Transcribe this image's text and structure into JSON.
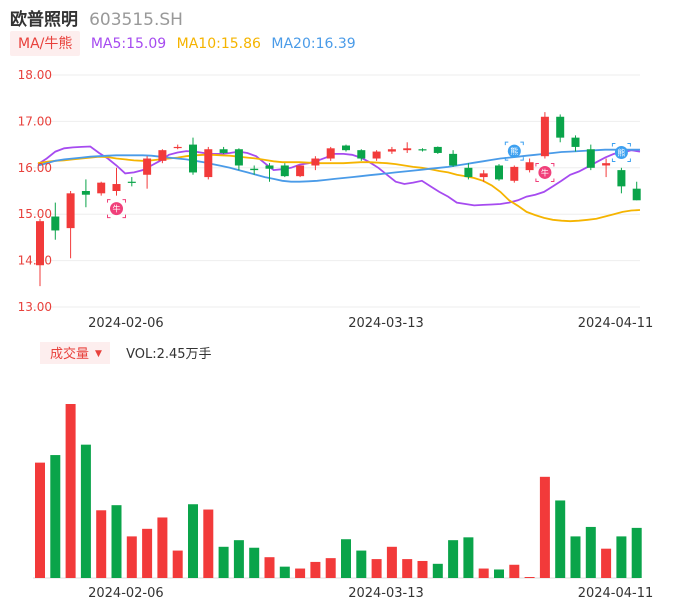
{
  "header": {
    "stock_name": "欧普照明",
    "stock_code": "603515.SH"
  },
  "ma_legend": {
    "tag": "MA/牛熊",
    "items": [
      {
        "label": "MA5:15.09",
        "color": "#a64bf0"
      },
      {
        "label": "MA10:15.86",
        "color": "#f5b400"
      },
      {
        "label": "MA20:16.39",
        "color": "#4a9be8"
      }
    ]
  },
  "volume_legend": {
    "tag": "成交量",
    "text": "VOL:2.45万手"
  },
  "colors": {
    "up": "#f23a3a",
    "down": "#0aa44a",
    "grid": "#eeeeee",
    "axis_label": "#e8413c",
    "bull_marker": "#f0407a",
    "bear_marker": "#3da0f0"
  },
  "chart_data": [
    {
      "type": "candlestick",
      "ylim": [
        13.0,
        18.0
      ],
      "yticks": [
        "13.00",
        "14.00",
        "15.00",
        "16.00",
        "17.00",
        "18.00"
      ],
      "xticks": [
        {
          "index": 3,
          "label": "2024-02-06"
        },
        {
          "index": 20,
          "label": "2024-03-13"
        },
        {
          "index": 35,
          "label": "2024-04-11"
        }
      ],
      "candles": [
        {
          "o": 13.9,
          "h": 14.9,
          "l": 13.45,
          "c": 14.85
        },
        {
          "o": 14.95,
          "h": 15.25,
          "l": 14.45,
          "c": 14.65
        },
        {
          "o": 14.7,
          "h": 15.5,
          "l": 14.05,
          "c": 15.45
        },
        {
          "o": 15.5,
          "h": 15.75,
          "l": 15.15,
          "c": 15.42
        },
        {
          "o": 15.45,
          "h": 15.7,
          "l": 15.4,
          "c": 15.68
        },
        {
          "o": 15.5,
          "h": 16.0,
          "l": 15.4,
          "c": 15.65
        },
        {
          "o": 15.7,
          "h": 15.8,
          "l": 15.6,
          "c": 15.68
        },
        {
          "o": 15.85,
          "h": 16.25,
          "l": 15.55,
          "c": 16.2
        },
        {
          "o": 16.15,
          "h": 16.4,
          "l": 16.1,
          "c": 16.38
        },
        {
          "o": 16.45,
          "h": 16.5,
          "l": 16.4,
          "c": 16.45
        },
        {
          "o": 16.5,
          "h": 16.65,
          "l": 15.85,
          "c": 15.9
        },
        {
          "o": 15.8,
          "h": 16.45,
          "l": 15.75,
          "c": 16.4
        },
        {
          "o": 16.4,
          "h": 16.45,
          "l": 16.3,
          "c": 16.32
        },
        {
          "o": 16.4,
          "h": 16.42,
          "l": 15.95,
          "c": 16.05
        },
        {
          "o": 15.98,
          "h": 16.05,
          "l": 15.85,
          "c": 15.95
        },
        {
          "o": 16.05,
          "h": 16.1,
          "l": 15.7,
          "c": 15.98
        },
        {
          "o": 16.05,
          "h": 16.1,
          "l": 15.8,
          "c": 15.82
        },
        {
          "o": 15.82,
          "h": 16.05,
          "l": 15.8,
          "c": 16.05
        },
        {
          "o": 16.05,
          "h": 16.25,
          "l": 15.95,
          "c": 16.2
        },
        {
          "o": 16.2,
          "h": 16.45,
          "l": 16.15,
          "c": 16.42
        },
        {
          "o": 16.48,
          "h": 16.5,
          "l": 16.35,
          "c": 16.38
        },
        {
          "o": 16.38,
          "h": 16.4,
          "l": 16.15,
          "c": 16.2
        },
        {
          "o": 16.2,
          "h": 16.38,
          "l": 16.15,
          "c": 16.35
        },
        {
          "o": 16.35,
          "h": 16.45,
          "l": 16.3,
          "c": 16.4
        },
        {
          "o": 16.38,
          "h": 16.55,
          "l": 16.32,
          "c": 16.42
        },
        {
          "o": 16.4,
          "h": 16.42,
          "l": 16.35,
          "c": 16.38
        },
        {
          "o": 16.45,
          "h": 16.46,
          "l": 16.3,
          "c": 16.32
        },
        {
          "o": 16.3,
          "h": 16.38,
          "l": 16.02,
          "c": 16.05
        },
        {
          "o": 16.0,
          "h": 16.1,
          "l": 15.75,
          "c": 15.8
        },
        {
          "o": 15.8,
          "h": 15.95,
          "l": 15.7,
          "c": 15.88
        },
        {
          "o": 16.05,
          "h": 16.08,
          "l": 15.72,
          "c": 15.75
        },
        {
          "o": 15.72,
          "h": 16.05,
          "l": 15.68,
          "c": 16.02
        },
        {
          "o": 15.95,
          "h": 16.2,
          "l": 15.9,
          "c": 16.12
        },
        {
          "o": 16.25,
          "h": 17.2,
          "l": 16.2,
          "c": 17.1
        },
        {
          "o": 17.1,
          "h": 17.15,
          "l": 16.55,
          "c": 16.65
        },
        {
          "o": 16.65,
          "h": 16.7,
          "l": 16.35,
          "c": 16.45
        },
        {
          "o": 16.4,
          "h": 16.5,
          "l": 15.95,
          "c": 16.0
        },
        {
          "o": 16.05,
          "h": 16.2,
          "l": 15.8,
          "c": 16.1
        },
        {
          "o": 15.95,
          "h": 16.0,
          "l": 15.45,
          "c": 15.6
        },
        {
          "o": 15.55,
          "h": 15.7,
          "l": 15.3,
          "c": 15.3
        }
      ],
      "ma5": [
        16.08,
        16.2,
        16.35,
        16.42,
        16.44,
        16.45,
        16.46,
        16.32,
        16.2,
        16.05,
        15.88,
        15.9,
        15.95,
        16.05,
        16.15,
        16.28,
        16.33,
        16.36,
        16.35,
        16.32,
        16.3,
        16.3,
        16.32,
        16.35,
        16.32,
        16.25,
        16.1,
        15.95,
        15.97,
        16.0,
        16.07,
        16.1,
        16.15,
        16.22,
        16.3,
        16.3,
        16.28,
        16.22,
        16.12,
        16.0,
        15.85,
        15.7,
        15.65,
        15.68,
        15.72,
        15.6,
        15.48,
        15.38,
        15.25,
        15.22,
        15.19,
        15.2,
        15.21,
        15.22,
        15.25,
        15.3,
        15.38,
        15.42,
        15.48,
        15.6,
        15.72,
        15.85,
        15.92,
        16.02,
        16.12,
        16.22,
        16.3,
        16.33,
        16.38,
        16.35
      ],
      "ma10": [
        16.1,
        16.13,
        16.15,
        16.16,
        16.18,
        16.2,
        16.22,
        16.24,
        16.23,
        16.2,
        16.18,
        16.16,
        16.15,
        16.16,
        16.18,
        16.2,
        16.22,
        16.25,
        16.27,
        16.28,
        16.28,
        16.27,
        16.26,
        16.24,
        16.22,
        16.2,
        16.17,
        16.14,
        16.12,
        16.12,
        16.12,
        16.11,
        16.1,
        16.1,
        16.1,
        16.1,
        16.11,
        16.12,
        16.12,
        16.11,
        16.1,
        16.08,
        16.05,
        16.02,
        16.0,
        15.97,
        15.93,
        15.9,
        15.85,
        15.82,
        15.78,
        15.72,
        15.62,
        15.48,
        15.3,
        15.18,
        15.05,
        14.98,
        14.92,
        14.88,
        14.86,
        14.85,
        14.86,
        14.88,
        14.9,
        14.95,
        15.0,
        15.05,
        15.08,
        15.09
      ],
      "ma20": [
        16.05,
        16.1,
        16.15,
        16.18,
        16.2,
        16.22,
        16.24,
        16.25,
        16.26,
        16.27,
        16.27,
        16.27,
        16.27,
        16.26,
        16.24,
        16.22,
        16.2,
        16.18,
        16.15,
        16.12,
        16.08,
        16.04,
        16.0,
        15.95,
        15.9,
        15.85,
        15.8,
        15.76,
        15.72,
        15.7,
        15.7,
        15.71,
        15.72,
        15.74,
        15.76,
        15.78,
        15.8,
        15.82,
        15.84,
        15.86,
        15.88,
        15.9,
        15.92,
        15.94,
        15.96,
        15.98,
        16.0,
        16.02,
        16.05,
        16.08,
        16.11,
        16.14,
        16.17,
        16.2,
        16.22,
        16.24,
        16.26,
        16.28,
        16.3,
        16.32,
        16.34,
        16.35,
        16.36,
        16.37,
        16.38,
        16.39,
        16.39,
        16.39,
        16.39,
        16.39
      ],
      "signals": [
        {
          "index": 5,
          "type": "bull",
          "label": "牛",
          "price": 15.12
        },
        {
          "index": 31,
          "type": "bear",
          "label": "熊",
          "price": 16.36
        },
        {
          "index": 33,
          "type": "bull",
          "label": "牛",
          "price": 15.9
        },
        {
          "index": 38,
          "type": "bear",
          "label": "熊",
          "price": 16.33
        }
      ]
    },
    {
      "type": "bar",
      "title": "成交量",
      "unit": "万手",
      "ylim": [
        0,
        9.2
      ],
      "values": [
        6.1,
        6.5,
        9.2,
        7.05,
        3.58,
        3.85,
        2.2,
        2.6,
        3.2,
        1.45,
        3.9,
        3.62,
        1.65,
        2.0,
        1.6,
        1.1,
        0.6,
        0.5,
        0.85,
        1.05,
        2.05,
        1.45,
        1.0,
        1.65,
        1.0,
        0.9,
        0.75,
        2.0,
        2.15,
        0.5,
        0.45,
        0.7,
        0.05,
        5.35,
        4.1,
        2.2,
        2.7,
        1.55,
        2.2,
        2.65
      ],
      "directions": [
        "up",
        "down",
        "up",
        "down",
        "up",
        "down",
        "up",
        "up",
        "up",
        "up",
        "down",
        "up",
        "down",
        "down",
        "down",
        "up",
        "down",
        "up",
        "up",
        "up",
        "down",
        "down",
        "up",
        "up",
        "up",
        "up",
        "down",
        "down",
        "down",
        "up",
        "down",
        "up",
        "up",
        "up",
        "down",
        "down",
        "down",
        "up",
        "down",
        "down"
      ]
    }
  ]
}
